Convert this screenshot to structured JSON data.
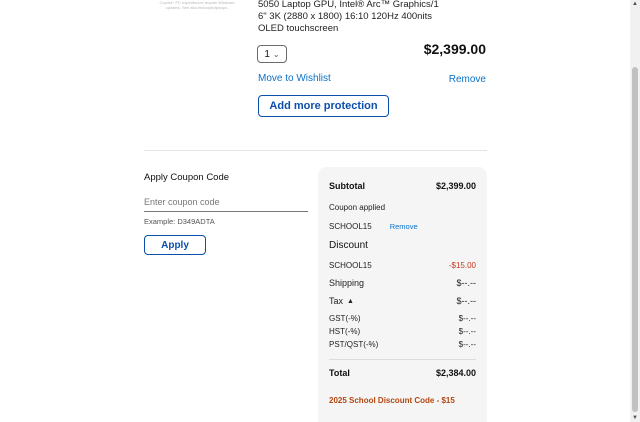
{
  "product": {
    "thumb_note": "Copilot+ PC experiences require Windows updates. See aka.ms/copilotpluspc.",
    "description": "5050 Laptop GPU, Intel® Arc™ Graphics/16\" 3K (2880 x 1800) 16:10 120Hz 400nits OLED touchscreen",
    "quantity": "1",
    "price": "$2,399.00",
    "move_to_wishlist": "Move to Wishlist",
    "remove": "Remove",
    "add_protection": "Add more protection"
  },
  "coupon": {
    "title": "Apply Coupon Code",
    "placeholder": "Enter coupon code",
    "example": "Example: D349ADTA",
    "apply": "Apply"
  },
  "summary": {
    "subtotal_label": "Subtotal",
    "subtotal_value": "$2,399.00",
    "coupon_applied_label": "Coupon applied",
    "coupon_code": "SCHOOL15",
    "coupon_remove": "Remove",
    "discount_label": "Discount",
    "discount_code": "SCHOOL15",
    "discount_value": "-$15.00",
    "shipping_label": "Shipping",
    "shipping_value": "$--.--",
    "tax_label": "Tax",
    "tax_value": "$--.--",
    "gst_label": "GST(-%)",
    "gst_value": "$--.--",
    "hst_label": "HST(-%)",
    "hst_value": "$--.--",
    "pst_label": "PST/QST(-%)",
    "pst_value": "$--.--",
    "total_label": "Total",
    "total_value": "$2,384.00",
    "promo_text": "2025 School Discount Code - $15"
  },
  "colors": {
    "link": "#0b72c8",
    "button_border": "#0b4fad",
    "discount": "#c4361b",
    "promo": "#b5460f"
  }
}
